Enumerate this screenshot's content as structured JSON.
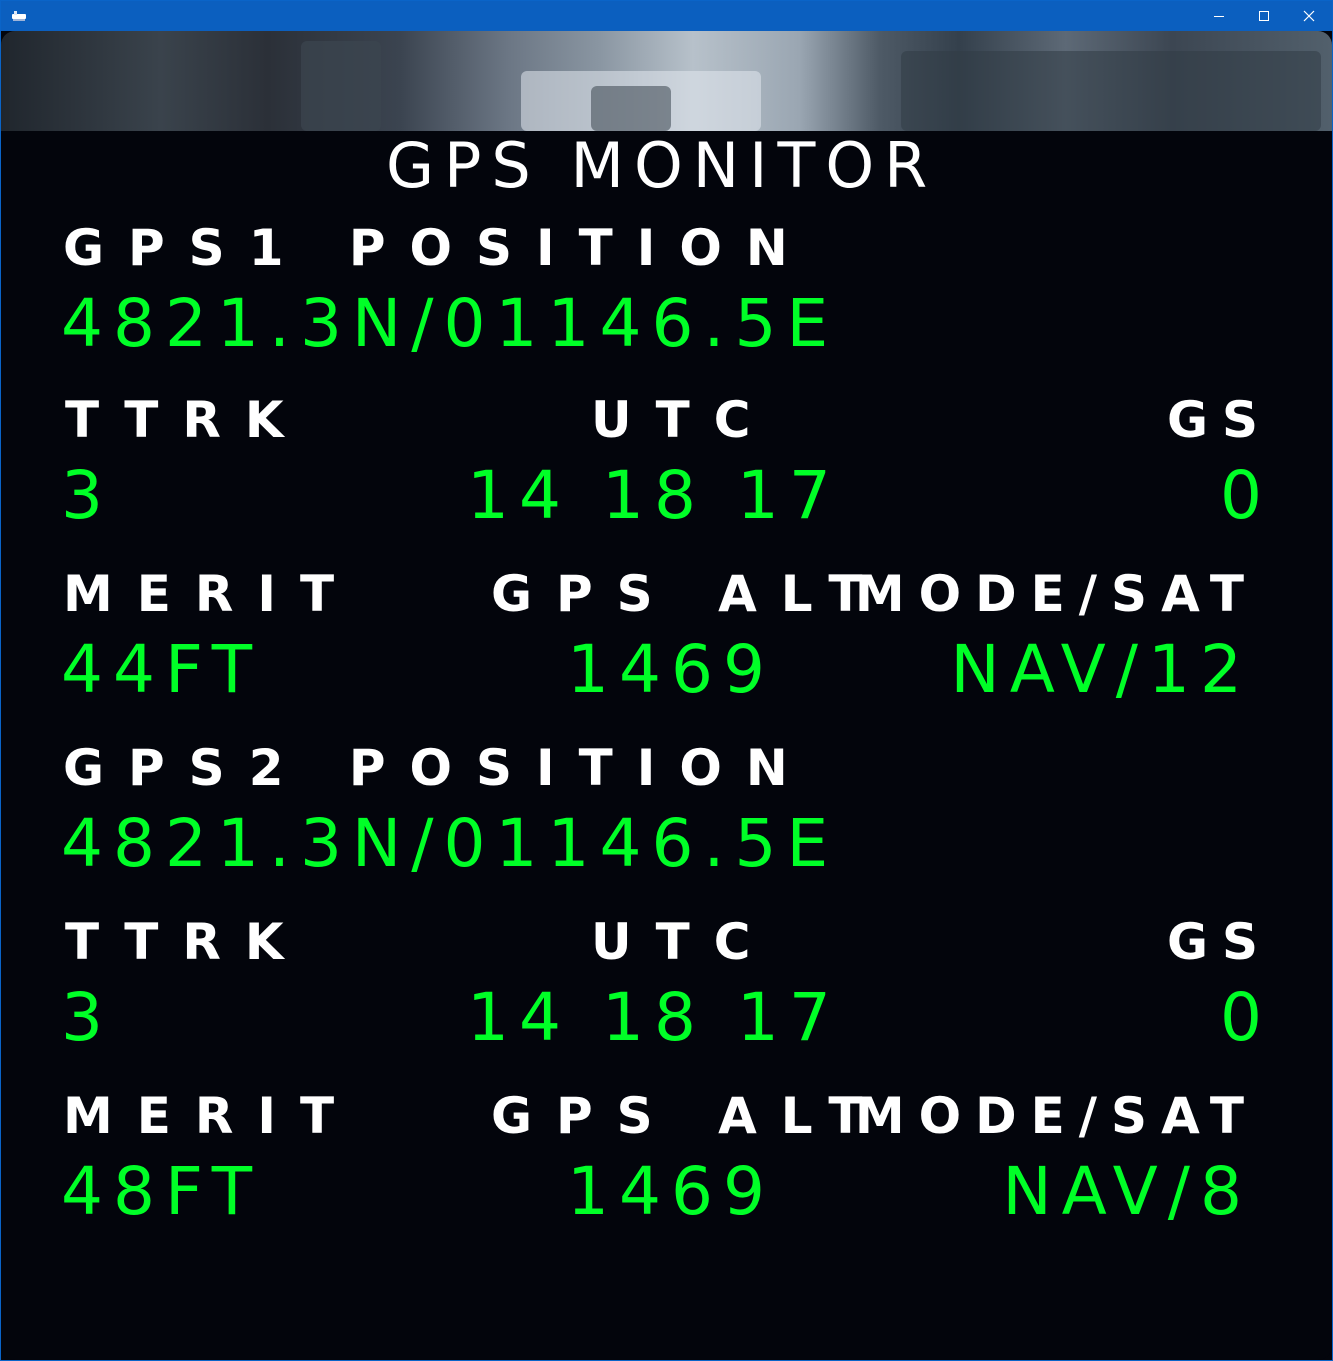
{
  "window": {
    "title_icon": "aircraft-app-icon",
    "controls": {
      "minimize": "minimize-icon",
      "maximize": "maximize-icon",
      "close": "close-icon"
    }
  },
  "colors": {
    "label": "#ffffff",
    "value": "#00ff27",
    "screen_bg": "#03050c",
    "titlebar": "#0b5fbf"
  },
  "page_title": "GPS MONITOR",
  "gps1": {
    "position_label": "GPS1 POSITION",
    "position": "4821.3N/01146.5E",
    "ttrk_label": "TTRK",
    "utc_label": "UTC",
    "gs_label": "GS",
    "ttrk": "3",
    "utc": "14 18 17",
    "gs": "0",
    "merit_label": "MERIT",
    "gps_alt_label": "GPS ALT",
    "mode_sat_label": "MODE/SAT",
    "merit": "44FT",
    "gps_alt": "1469",
    "mode_sat": "NAV/12"
  },
  "gps2": {
    "position_label": "GPS2 POSITION",
    "position": "4821.3N/01146.5E",
    "ttrk_label": "TTRK",
    "utc_label": "UTC",
    "gs_label": "GS",
    "ttrk": "3",
    "utc": "14 18 17",
    "gs": "0",
    "merit_label": "MERIT",
    "gps_alt_label": "GPS ALT",
    "mode_sat_label": "MODE/SAT",
    "merit": "48FT",
    "gps_alt": "1469",
    "mode_sat": "NAV/8"
  }
}
